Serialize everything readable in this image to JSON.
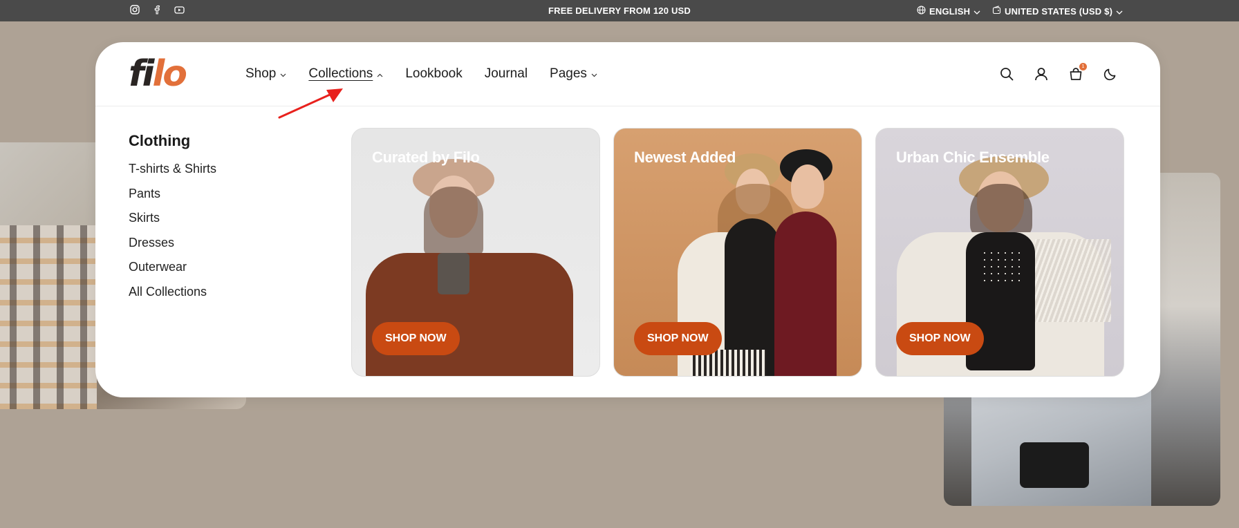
{
  "topbar": {
    "promo": "FREE DELIVERY FROM 120 USD",
    "language": "ENGLISH",
    "currency": "UNITED STATES (USD $)",
    "social_icons": [
      "instagram-icon",
      "facebook-icon",
      "youtube-icon"
    ]
  },
  "header": {
    "logo_part1": "fi",
    "logo_part2": "lo",
    "nav": [
      {
        "label": "Shop",
        "has_dropdown": true
      },
      {
        "label": "Collections",
        "has_dropdown": true,
        "active": true
      },
      {
        "label": "Lookbook",
        "has_dropdown": false
      },
      {
        "label": "Journal",
        "has_dropdown": false
      },
      {
        "label": "Pages",
        "has_dropdown": true
      }
    ],
    "icons": [
      "search-icon",
      "account-icon",
      "cart-icon",
      "dark-mode-icon"
    ],
    "cart_count": "1"
  },
  "mega_menu": {
    "heading": "Clothing",
    "links": [
      "T-shirts & Shirts",
      "Pants",
      "Skirts",
      "Dresses",
      "Outerwear",
      "All Collections"
    ],
    "promos": [
      {
        "title": "Curated by Filo",
        "button": "SHOP NOW"
      },
      {
        "title": "Newest Added",
        "button": "SHOP NOW"
      },
      {
        "title": "Urban Chic Ensemble",
        "button": "SHOP NOW"
      }
    ]
  },
  "colors": {
    "accent": "#e2703a",
    "button": "#c94a12",
    "topbar": "#4a4a4a",
    "page_bg": "#aea295"
  }
}
